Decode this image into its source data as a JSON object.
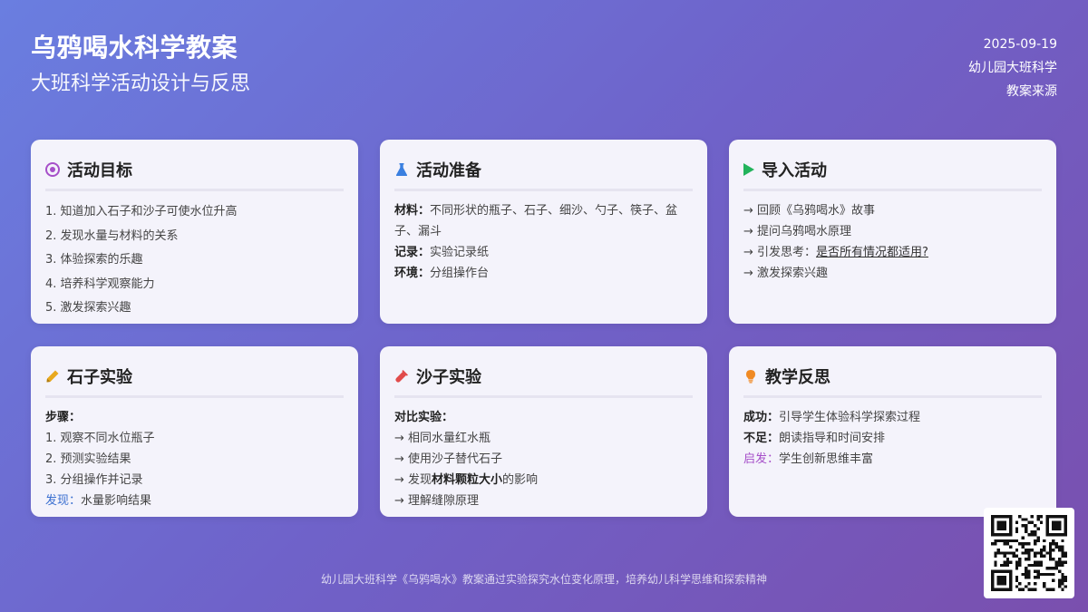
{
  "header": {
    "title": "乌鸦喝水科学教案",
    "subtitle": "大班科学活动设计与反思",
    "date": "2025-09-19",
    "category": "幼儿园大班科学",
    "source": "教案来源"
  },
  "cards": {
    "goals": {
      "title": "活动目标",
      "items": [
        "1. 知道加入石子和沙子可使水位升高",
        "2. 发现水量与材料的关系",
        "3. 体验探索的乐趣",
        "4. 培养科学观察能力",
        "5. 激发探索兴趣"
      ]
    },
    "prep": {
      "title": "活动准备",
      "materials_label": "材料：",
      "materials_value": "不同形状的瓶子、石子、细沙、勺子、筷子、盆子、漏斗",
      "record_label": "记录：",
      "record_value": "实验记录纸",
      "env_label": "环境：",
      "env_value": "分组操作台"
    },
    "intro": {
      "title": "导入活动",
      "items": [
        "→ 回顾《乌鸦喝水》故事",
        "→ 提问乌鸦喝水原理",
        "→ 引发思考："
      ],
      "question": "是否所有情况都适用?",
      "last": "→ 激发探索兴趣"
    },
    "stone": {
      "title": "石子实验",
      "steps_label": "步骤：",
      "steps": [
        "1. 观察不同水位瓶子",
        "2. 预测实验结果",
        "3. 分组操作并记录"
      ],
      "finding_label": "发现：",
      "finding_value": "水量影响结果"
    },
    "sand": {
      "title": "沙子实验",
      "compare_label": "对比实验：",
      "items": [
        "→ 相同水量红水瓶",
        "→ 使用沙子替代石子"
      ],
      "discover_prefix": "→ 发现",
      "discover_bold": "材料颗粒大小",
      "discover_suffix": "的影响",
      "last": "→ 理解缝隙原理"
    },
    "reflection": {
      "title": "教学反思",
      "success_label": "成功：",
      "success_value": "引导学生体验科学探索过程",
      "lack_label": "不足：",
      "lack_value": "朗读指导和时间安排",
      "insight_label": "启发：",
      "insight_value": "学生创新思维丰富"
    }
  },
  "footer": {
    "text": "幼儿园大班科学《乌鸦喝水》教案通过实验探究水位变化原理，培养幼儿科学思维和探索精神"
  },
  "icons": {
    "goals": "target-icon",
    "prep": "flask-icon",
    "intro": "play-icon",
    "stone": "pencil-icon",
    "sand": "test-tube-icon",
    "reflection": "lightbulb-icon",
    "qr": "qr-code"
  },
  "colors": {
    "target": "#a64fc9",
    "flask": "#3a7fe0",
    "play": "#22b35b",
    "pencil": "#e8a91e",
    "tube": "#e14b4b",
    "bulb": "#f08a24"
  }
}
